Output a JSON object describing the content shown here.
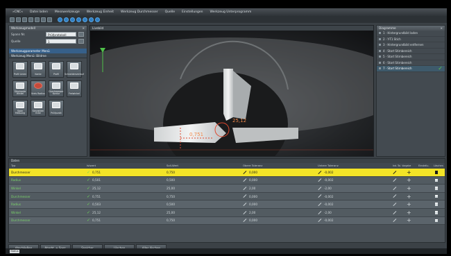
{
  "menu": [
    "»CNC«",
    "Datei laden",
    "Messwerkzeuge",
    "Werkzeug Einheit",
    "Werkzeug Durchmesser",
    "Quelle",
    "Einstellungen",
    "Werkzeug Unterprogramm"
  ],
  "left_panel": {
    "title": "Werkzeugmodell",
    "fields": [
      {
        "label": "Spann Nr.",
        "value": "Prüfprotokoll"
      },
      {
        "label": "Quelle",
        "value": "1"
      }
    ],
    "section_title": "Werkzeugparameter Menü",
    "section_sub": "Werkzeug Menü: Bildme",
    "tiles": [
      {
        "label": "Profil Linien",
        "icon": "profile-lines-icon",
        "red": false
      },
      {
        "label": "Kante",
        "icon": "edge-icon",
        "red": false
      },
      {
        "label": "Profil",
        "icon": "profile-icon",
        "red": false
      },
      {
        "label": "Schneidenverlauf",
        "icon": "cutting-edge-icon",
        "red": false
      },
      {
        "label": "Stirnkante Winkel",
        "icon": "angle-icon",
        "red": false
      },
      {
        "label": "Kreis Radius",
        "icon": "circle-radius-icon",
        "red": true
      },
      {
        "label": "Durchmesser Kontur",
        "icon": "diameter-icon",
        "red": false
      },
      {
        "label": "Freiwinkel",
        "icon": "clearance-angle-icon",
        "red": false
      },
      {
        "label": "Span Messung",
        "icon": "chip-measure-icon",
        "red": false
      },
      {
        "label": "Schneiden Ecke",
        "icon": "corner-icon",
        "red": false
      },
      {
        "label": "Prüfpunkt",
        "icon": "check-point-icon",
        "red": false
      }
    ]
  },
  "view": {
    "title": "Livebild",
    "measure_diameter": "0,751",
    "measure_angle": "25,12"
  },
  "right_panel": {
    "title": "Diagramme",
    "items": [
      {
        "label": "1 · Hintergrundbild laden",
        "active": false
      },
      {
        "label": "2 · Y-T1 Stich",
        "active": false
      },
      {
        "label": "3 · Hintergrundbild entfernen",
        "active": false
      },
      {
        "label": "4 · Start Stirnbereich",
        "active": false
      },
      {
        "label": "5 · Start Stirnbereich",
        "active": false
      },
      {
        "label": "6 · Start Stirnbereich",
        "active": false
      },
      {
        "label": "7 · Start Stirnbereich",
        "active": true
      }
    ]
  },
  "table": {
    "title": "Daten",
    "headers": {
      "feature": "Typ",
      "actual": "Istwert",
      "nominal": "Soll-Wert",
      "upper": "Obere Toleranz",
      "lower": "Untere Toleranz",
      "edit": "Ind. Tol. Vorgabe",
      "add": "Einstellu.",
      "delete": "Löschen"
    },
    "rows": [
      {
        "feature": "Durchmesser",
        "actual": "0,751",
        "nominal": "0,750",
        "upper": "0,000",
        "lower": "-0,002",
        "selected": true
      },
      {
        "feature": "Radius",
        "actual": "0,501",
        "nominal": "0,500",
        "upper": "0,000",
        "lower": "-0,002",
        "selected": false
      },
      {
        "feature": "Winkel",
        "actual": "25,12",
        "nominal": "25,00",
        "upper": "2,00",
        "lower": "-2,00",
        "selected": false
      },
      {
        "feature": "Durchmesser",
        "actual": "0,751",
        "nominal": "0,750",
        "upper": "0,000",
        "lower": "-0,002",
        "selected": false
      },
      {
        "feature": "Radius",
        "actual": "0,503",
        "nominal": "0,500",
        "upper": "0,000",
        "lower": "-0,002",
        "selected": false
      },
      {
        "feature": "Winkel",
        "actual": "25,12",
        "nominal": "25,00",
        "upper": "2,00",
        "lower": "-2,00",
        "selected": false
      },
      {
        "feature": "Durchmesser",
        "actual": "0,751",
        "nominal": "0,750",
        "upper": "0,000",
        "lower": "-0,002",
        "selected": false
      }
    ]
  },
  "bottom_buttons": [
    "Abschließen",
    "Abarbt. + Spez.",
    "Speicher",
    "Löschen",
    "Alles löschen"
  ],
  "status": {
    "pill": "Status"
  }
}
